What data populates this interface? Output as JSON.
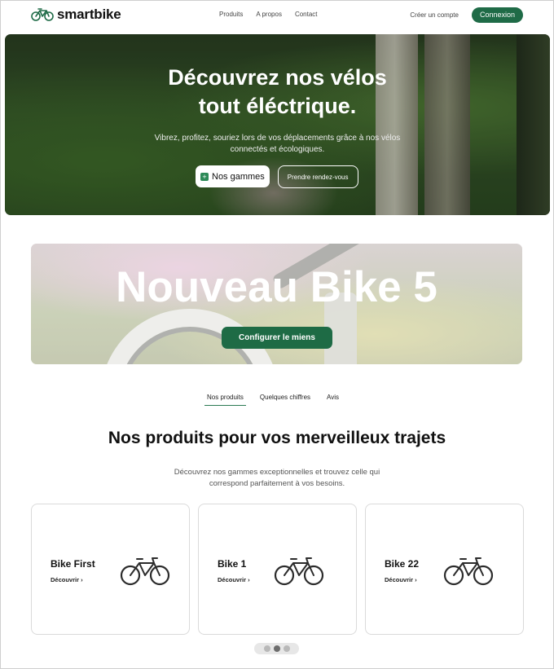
{
  "brand": {
    "name": "smartbike",
    "logo_icon": "bicycle-icon",
    "accent_color": "#1f6b47"
  },
  "nav": {
    "links": [
      "Produits",
      "A propos",
      "Contact"
    ],
    "create_account": "Créer un compte",
    "login": "Connexion"
  },
  "hero": {
    "title_line1": "Découvrez nos vélos",
    "title_line2": "tout éléctrique.",
    "subtitle": "Vibrez, profitez, souriez lors de vos déplacements grâce à nos vélos connectés et écologiques.",
    "btn_primary": "Nos gammes",
    "btn_primary_icon": "plus-icon",
    "btn_secondary": "Prendre rendez-vous"
  },
  "promo": {
    "title": "Nouveau Bike 5",
    "button": "Configurer le miens"
  },
  "tabs": [
    {
      "label": "Nos produits",
      "active": true
    },
    {
      "label": "Quelques chiffres",
      "active": false
    },
    {
      "label": "Avis",
      "active": false
    }
  ],
  "products_section": {
    "title": "Nos produits pour vos merveilleux trajets",
    "subtitle": "Découvrez nos gammes exceptionnelles et trouvez celle qui correspond parfaitement à vos besoins."
  },
  "products": [
    {
      "name": "Bike First",
      "link": "Découvrir",
      "icon": "bicycle-icon"
    },
    {
      "name": "Bike 1",
      "link": "Découvrir",
      "icon": "bicycle-icon"
    },
    {
      "name": "Bike 22",
      "link": "Découvrir",
      "icon": "bicycle-icon"
    }
  ],
  "carousel": {
    "pages": 3,
    "active_page": 2
  }
}
